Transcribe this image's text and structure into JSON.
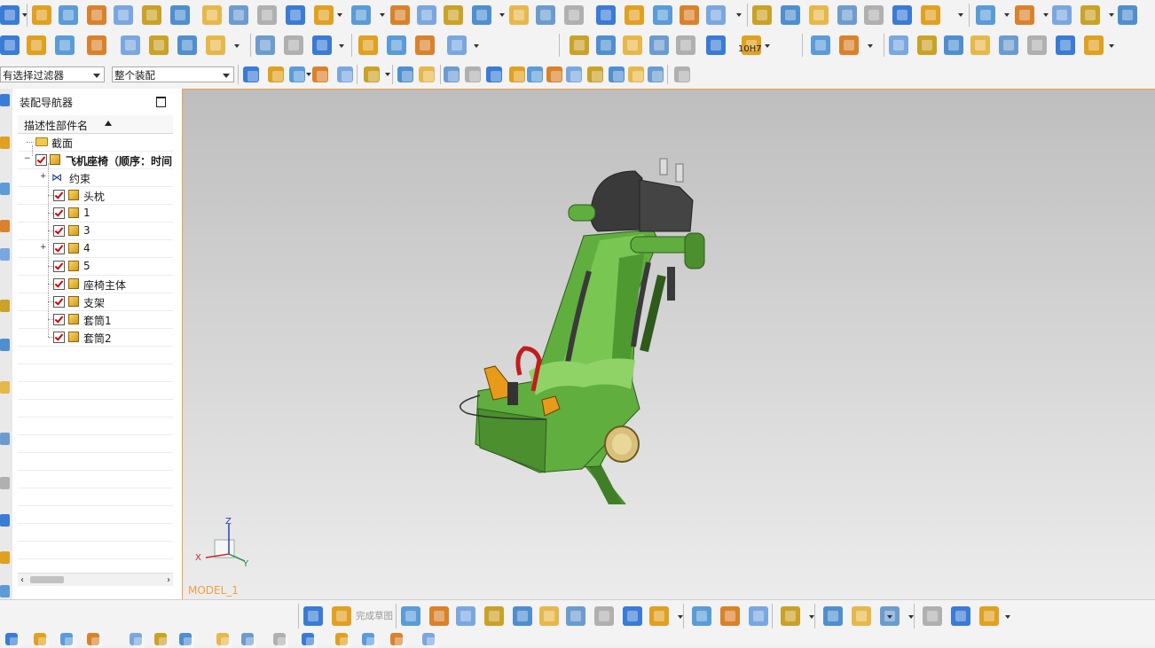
{
  "toolbar": {
    "selection_filter": "有选择过滤器",
    "assembly_scope": "整个装配",
    "tolerance_label": "10H7"
  },
  "navigator": {
    "title": "装配导航器",
    "column_header": "描述性部件名",
    "items": [
      {
        "label": "截面",
        "type": "folder"
      },
      {
        "label": "飞机座椅（顺序：时间",
        "type": "assembly"
      },
      {
        "label": "约束",
        "type": "constraints"
      },
      {
        "label": "头枕",
        "type": "part"
      },
      {
        "label": "1",
        "type": "part"
      },
      {
        "label": "3",
        "type": "part"
      },
      {
        "label": "4",
        "type": "subassembly"
      },
      {
        "label": "5",
        "type": "part"
      },
      {
        "label": "座椅主体",
        "type": "part"
      },
      {
        "label": "支架",
        "type": "part"
      },
      {
        "label": "套筒1",
        "type": "part"
      },
      {
        "label": "套筒2",
        "type": "part"
      }
    ]
  },
  "viewport": {
    "model_name": "MODEL_1",
    "triad": {
      "x": "X",
      "y": "Y",
      "z": "Z"
    }
  },
  "sketch_toolbar": {
    "finish_sketch": "完成草图"
  },
  "colors": {
    "model_green": "#5fae3e",
    "headrest_dark": "#3a3a3a",
    "accent_orange": "#f0a040"
  }
}
